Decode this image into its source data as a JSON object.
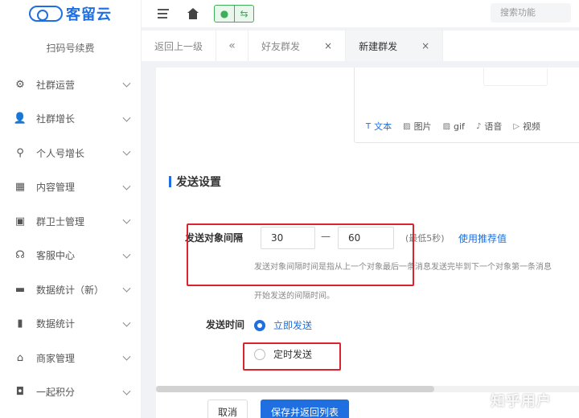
{
  "logo": {
    "text": "客留云"
  },
  "sidebar": {
    "scan_renew": "扫码号续费",
    "items": [
      {
        "label": "社群运营",
        "icon": "gear-icon"
      },
      {
        "label": "社群增长",
        "icon": "users-icon"
      },
      {
        "label": "个人号增长",
        "icon": "org-tree-icon"
      },
      {
        "label": "内容管理",
        "icon": "grid-icon"
      },
      {
        "label": "群卫士管理",
        "icon": "shield-screen-icon"
      },
      {
        "label": "客服中心",
        "icon": "headset-icon"
      },
      {
        "label": "数据统计（新）",
        "icon": "monitor-icon"
      },
      {
        "label": "数据统计",
        "icon": "bar-chart-icon"
      },
      {
        "label": "商家管理",
        "icon": "store-icon"
      },
      {
        "label": "一起积分",
        "icon": "bag-icon"
      }
    ]
  },
  "topbar": {
    "search_placeholder": "搜索功能"
  },
  "tabs": {
    "back": "返回上一级",
    "friend_group_send": "好友群发",
    "new_group_send": "新建群发",
    "close": "×",
    "scroll_left": "«"
  },
  "editor": {
    "tools": [
      {
        "label": "文本",
        "icon": "text-icon"
      },
      {
        "label": "图片",
        "icon": "image-icon"
      },
      {
        "label": "gif",
        "icon": "gif-icon"
      },
      {
        "label": "语音",
        "icon": "voice-icon"
      },
      {
        "label": "视频",
        "icon": "video-icon"
      }
    ]
  },
  "send_settings": {
    "title": "发送设置",
    "interval_label": "发送对象间隔",
    "interval_min": "30",
    "interval_sep": "—",
    "interval_max": "60",
    "min_note": "(最低5秒)",
    "recommend_link": "使用推荐值",
    "hint_line1": "发送对象间隔时间是指从上一个对象最后一条消息发送完毕到下一个对象第一条消息",
    "hint_line2": "开始发送的间隔时间。",
    "time_label": "发送时间",
    "option_now": "立即发送",
    "option_scheduled": "定时发送",
    "selected": "立即发送"
  },
  "actions": {
    "cancel": "取消",
    "save": "保存并返回列表"
  },
  "watermark": "知乎用户",
  "colors": {
    "primary": "#1f6fe0",
    "annotation_red": "#d9232d",
    "wechat_green": "#3fae5a"
  }
}
